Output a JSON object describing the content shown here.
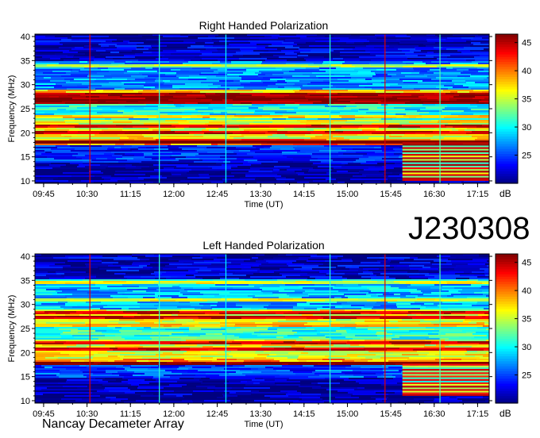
{
  "observation_id": "J230308",
  "instrument": "Nancay Decameter Array",
  "colorbar": {
    "unit_label": "dB",
    "ticks": [
      25,
      30,
      35,
      40,
      45
    ],
    "range": [
      20,
      46.5
    ],
    "colormap": [
      "#00007f",
      "#0000ff",
      "#007fff",
      "#00ffff",
      "#7fff7f",
      "#ffff00",
      "#ff7f00",
      "#ff0000",
      "#7f0000"
    ]
  },
  "chart_data": [
    {
      "type": "heatmap",
      "title": "Right Handed Polarization",
      "xlabel": "Time (UT)",
      "ylabel": "Frequency (MHz)",
      "x_ticks": [
        "09:45",
        "10:30",
        "11:15",
        "12:00",
        "12:45",
        "13:30",
        "14:15",
        "15:00",
        "15:45",
        "16:30",
        "17:15"
      ],
      "y_ticks": [
        10,
        15,
        20,
        25,
        30,
        35,
        40
      ],
      "ylim": [
        9.5,
        40.5
      ],
      "xlim_hours": [
        9.6,
        17.45
      ],
      "zlim_db": [
        20,
        46.5
      ],
      "bands": [
        {
          "f": [
            10,
            14
          ],
          "level": 21
        },
        {
          "f": [
            14,
            17.5
          ],
          "level": 24
        },
        {
          "f": [
            17.5,
            19
          ],
          "level": 40
        },
        {
          "f": [
            19,
            23
          ],
          "level": 36
        },
        {
          "f": [
            23,
            26
          ],
          "level": 30
        },
        {
          "f": [
            26,
            29
          ],
          "level": 38
        },
        {
          "f": [
            29,
            35
          ],
          "level": 27
        },
        {
          "f": [
            35,
            40
          ],
          "level": 22
        }
      ],
      "strong_lines_mhz": [
        18.1,
        20.3,
        21.6,
        23.5,
        26.6,
        27.3,
        28.2,
        34.2
      ],
      "late_burst": {
        "t": [
          15.95,
          17.45
        ],
        "f": [
          10,
          18
        ],
        "level": 43
      },
      "vertical_lines": [
        {
          "t": 10.55,
          "level": 44
        },
        {
          "t": 11.75,
          "level": 31
        },
        {
          "t": 12.9,
          "level": 30
        },
        {
          "t": 14.7,
          "level": 31
        },
        {
          "t": 15.65,
          "level": 44
        },
        {
          "t": 16.6,
          "level": 32
        }
      ]
    },
    {
      "type": "heatmap",
      "title": "Left Handed Polarization",
      "xlabel": "Time (UT)",
      "ylabel": "Frequency (MHz)",
      "x_ticks": [
        "09:45",
        "10:30",
        "11:15",
        "12:00",
        "12:45",
        "13:30",
        "14:15",
        "15:00",
        "15:45",
        "16:30",
        "17:15"
      ],
      "y_ticks": [
        10,
        15,
        20,
        25,
        30,
        35,
        40
      ],
      "ylim": [
        9.5,
        40.5
      ],
      "xlim_hours": [
        9.6,
        17.45
      ],
      "zlim_db": [
        20,
        46.5
      ],
      "bands": [
        {
          "f": [
            10,
            15
          ],
          "level": 21
        },
        {
          "f": [
            15,
            17.5
          ],
          "level": 25
        },
        {
          "f": [
            17.5,
            19
          ],
          "level": 39
        },
        {
          "f": [
            19,
            23
          ],
          "level": 36
        },
        {
          "f": [
            23,
            26
          ],
          "level": 31
        },
        {
          "f": [
            26,
            29
          ],
          "level": 36
        },
        {
          "f": [
            29,
            35
          ],
          "level": 28
        },
        {
          "f": [
            35,
            40
          ],
          "level": 22
        }
      ],
      "strong_lines_mhz": [
        18.0,
        20.8,
        22.3,
        25.7,
        27.4,
        28.6,
        31.2,
        34.9
      ],
      "late_burst": {
        "t": [
          15.95,
          17.45
        ],
        "f": [
          11,
          17.5
        ],
        "level": 42
      },
      "vertical_lines": [
        {
          "t": 10.55,
          "level": 44
        },
        {
          "t": 11.75,
          "level": 31
        },
        {
          "t": 12.9,
          "level": 30
        },
        {
          "t": 14.7,
          "level": 31
        },
        {
          "t": 15.65,
          "level": 44
        },
        {
          "t": 16.6,
          "level": 32
        }
      ]
    }
  ]
}
